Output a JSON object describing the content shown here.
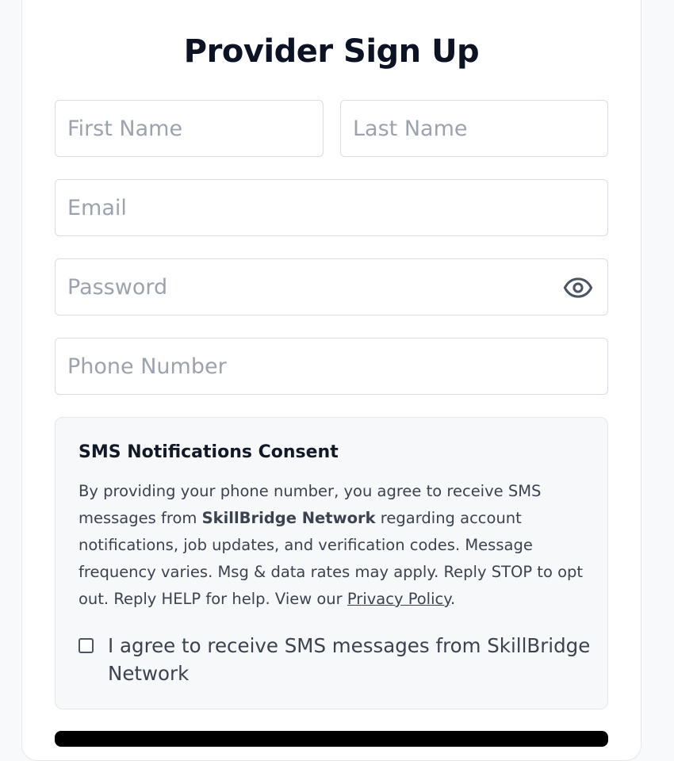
{
  "page": {
    "title": "Provider Sign Up"
  },
  "form": {
    "first_name": {
      "placeholder": "First Name",
      "value": ""
    },
    "last_name": {
      "placeholder": "Last Name",
      "value": ""
    },
    "email": {
      "placeholder": "Email",
      "value": ""
    },
    "password": {
      "placeholder": "Password",
      "value": "",
      "toggle_icon": "eye-icon"
    },
    "phone": {
      "placeholder": "Phone Number",
      "value": ""
    }
  },
  "sms_consent": {
    "title": "SMS Notifications Consent",
    "text_before_brand": "By providing your phone number, you agree to receive SMS messages from ",
    "brand": "SkillBridge Network",
    "text_after_brand": " regarding account notifications, job updates, and verification codes. Message frequency varies. Msg & data rates may apply. Reply STOP to opt out. Reply HELP for help. View our ",
    "privacy_link": "Privacy Policy",
    "text_end": ".",
    "checkbox_label": "I agree to receive SMS messages from SkillBridge Network",
    "checked": false
  },
  "colors": {
    "title": "#0b1324",
    "placeholder": "#9ca3af",
    "body_text": "#3b4250",
    "panel_bg": "#f7f8fa",
    "submit_button": "#000000"
  }
}
